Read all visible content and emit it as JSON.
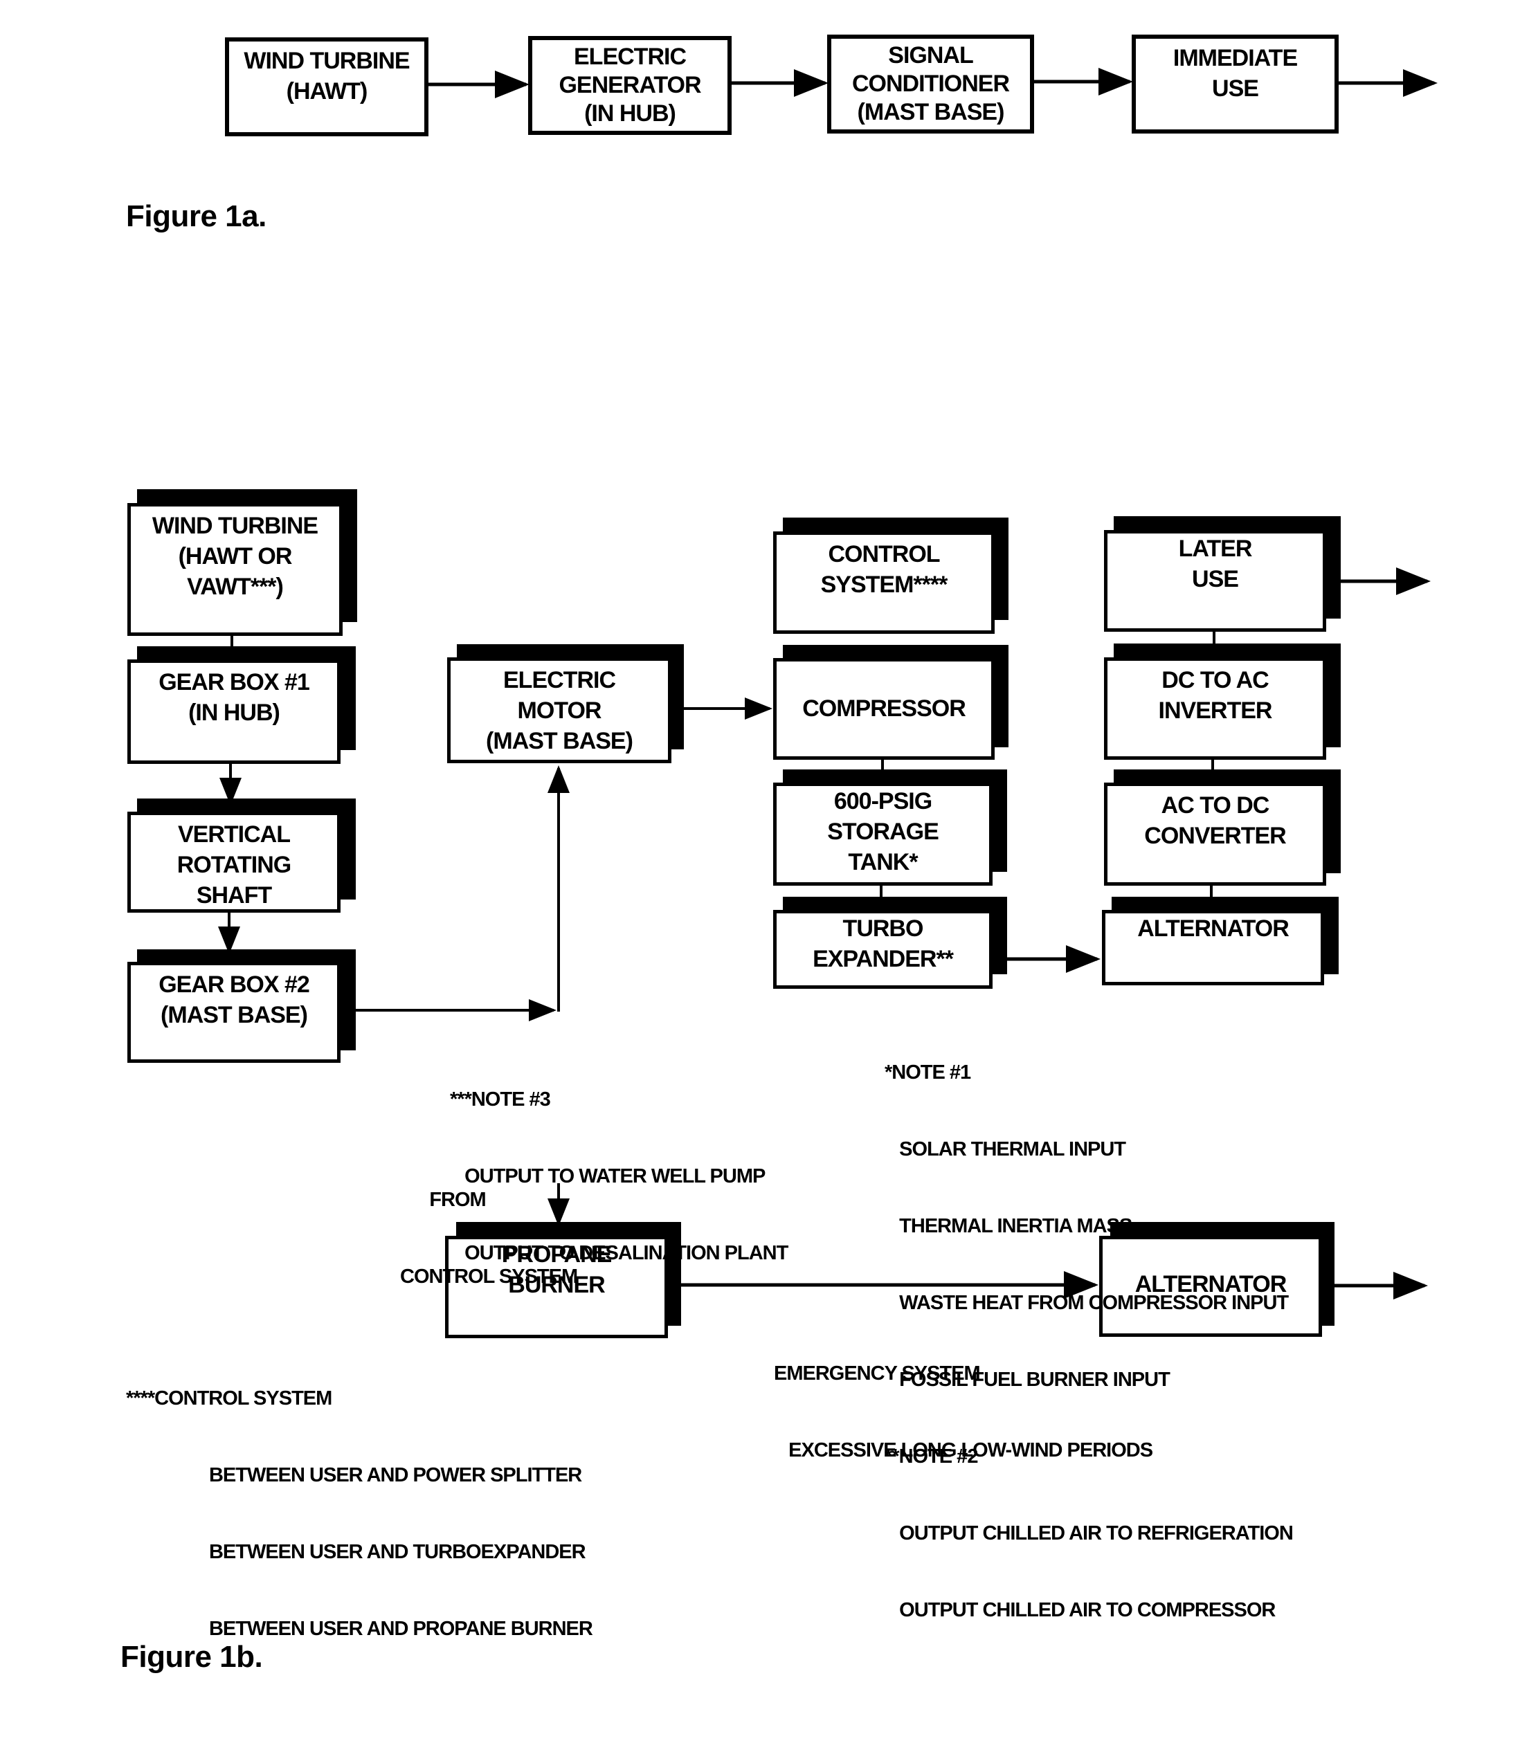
{
  "figure_1a": {
    "caption": "Figure 1a.",
    "boxes": [
      {
        "id": "wind-turbine",
        "lines": [
          "WIND TURBINE",
          "(HAWT)"
        ]
      },
      {
        "id": "electric-generator",
        "lines": [
          "ELECTRIC",
          "GENERATOR",
          "(IN HUB)"
        ]
      },
      {
        "id": "signal-conditioner",
        "lines": [
          "SIGNAL",
          "CONDITIONER",
          "(MAST BASE)"
        ]
      },
      {
        "id": "immediate-use",
        "lines": [
          "IMMEDIATE",
          "USE"
        ]
      }
    ]
  },
  "figure_1b": {
    "caption": "Figure 1b.",
    "boxes": {
      "wind_turbine": [
        "WIND TURBINE",
        "(HAWT OR",
        "VAWT***)"
      ],
      "gear_box_1": [
        "GEAR BOX #1",
        "(IN HUB)"
      ],
      "vertical_shaft": [
        "VERTICAL",
        "ROTATING",
        "SHAFT"
      ],
      "gear_box_2": [
        "GEAR BOX #2",
        "(MAST BASE)"
      ],
      "electric_motor": [
        "ELECTRIC",
        "MOTOR",
        "(MAST BASE)"
      ],
      "control_system": [
        "CONTROL",
        "SYSTEM****"
      ],
      "compressor": [
        "COMPRESSOR"
      ],
      "storage_tank": [
        "600-PSIG",
        "STORAGE",
        "TANK*"
      ],
      "turbo_expander": [
        "TURBO",
        "EXPANDER**"
      ],
      "later_use": [
        "LATER",
        "USE"
      ],
      "dc_to_ac": [
        "DC TO AC",
        "INVERTER"
      ],
      "ac_to_dc": [
        "AC TO DC",
        "CONVERTER"
      ],
      "alternator_1": [
        "ALTERNATOR"
      ],
      "propane_burner": [
        "PROPANE",
        "BURNER"
      ],
      "alternator_2": [
        "ALTERNATOR"
      ]
    },
    "notes": {
      "note_3": [
        "***NOTE #3",
        "   OUTPUT TO WATER WELL PUMP",
        "   OUTPUT TO DESALINATION PLANT"
      ],
      "note_1": [
        "*NOTE #1",
        "   SOLAR THERMAL INPUT",
        "   THERMAL INERTIA MASS",
        "   WASTE HEAT FROM COMPRESSOR INPUT",
        "   FOSSIL FUEL BURNER INPUT"
      ],
      "note_2": [
        "**NOTE #2",
        "   OUTPUT CHILLED AIR TO REFRIGERATION",
        "   OUTPUT CHILLED AIR TO COMPRESSOR"
      ],
      "from_control": [
        "      FROM",
        "CONTROL SYSTEM"
      ],
      "control_note": [
        "****CONTROL SYSTEM",
        "                 BETWEEN USER AND POWER SPLITTER",
        "                 BETWEEN USER AND TURBOEXPANDER",
        "                 BETWEEN USER AND PROPANE BURNER"
      ],
      "emergency": [
        "EMERGENCY SYSTEM",
        "   EXCESSIVE LONG LOW-WIND PERIODS"
      ]
    }
  }
}
